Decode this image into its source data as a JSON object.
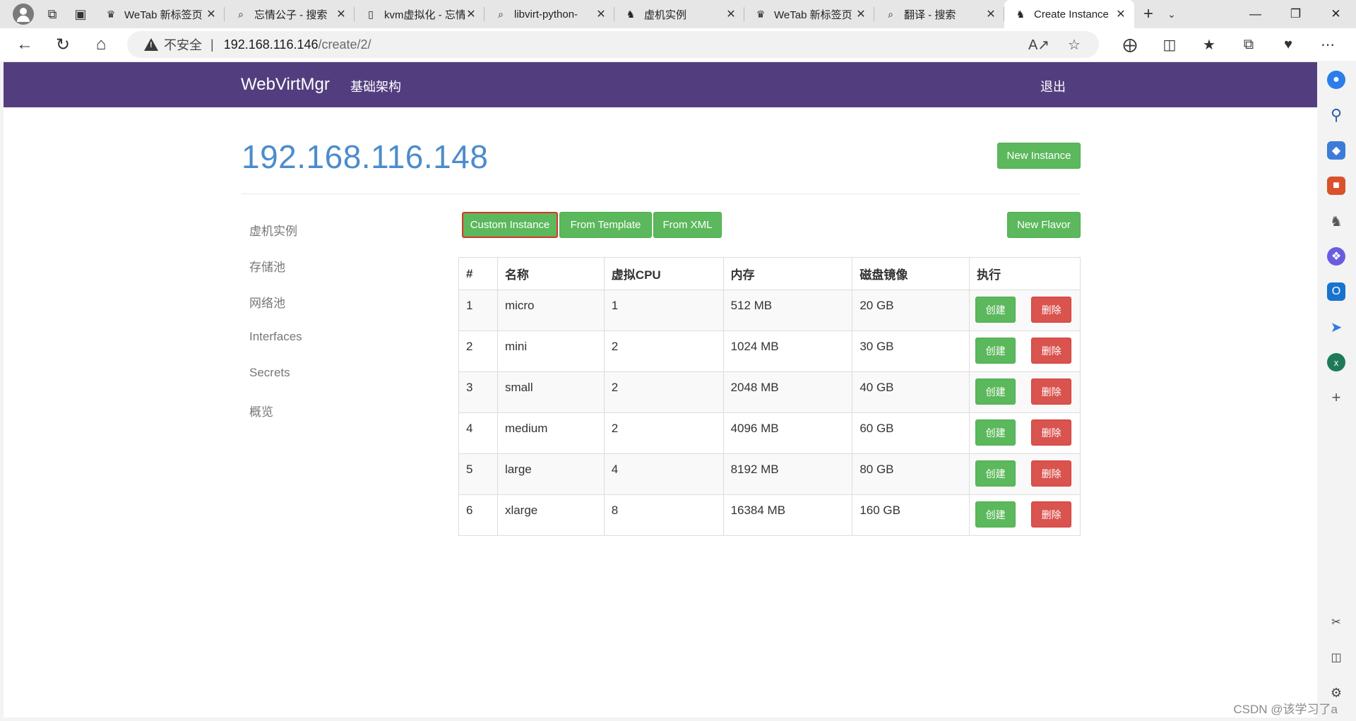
{
  "browser": {
    "tabs": [
      {
        "title": "WeTab 新标签页",
        "icon": "wetab-icon",
        "active": false
      },
      {
        "title": "忘情公子 - 搜索",
        "icon": "search-icon",
        "active": false
      },
      {
        "title": "kvm虚拟化 - 忘情公子",
        "icon": "page-icon",
        "active": false
      },
      {
        "title": "libvirt-python-",
        "icon": "search-icon",
        "active": false
      },
      {
        "title": "虚机实例",
        "icon": "webvirtmgr-icon",
        "active": false
      },
      {
        "title": "WeTab 新标签页",
        "icon": "wetab-icon",
        "active": false
      },
      {
        "title": "翻译 - 搜索",
        "icon": "search-icon",
        "active": false
      },
      {
        "title": "Create Instance",
        "icon": "webvirtmgr-icon",
        "active": true
      }
    ],
    "address": {
      "security_label": "不安全",
      "host": "192.168.116.146",
      "path": "/create/2/"
    }
  },
  "app": {
    "brand": "WebVirtMgr",
    "nav_link": "基础架构",
    "logout": "退出"
  },
  "page": {
    "title": "192.168.116.148",
    "new_instance": "New Instance",
    "custom_instance": "Custom Instance",
    "from_template": "From Template",
    "from_xml": "From XML",
    "new_flavor": "New Flavor"
  },
  "sidebar": {
    "items": [
      {
        "label": "虚机实例"
      },
      {
        "label": "存储池"
      },
      {
        "label": "网络池"
      },
      {
        "label": "Interfaces"
      },
      {
        "label": "Secrets"
      },
      {
        "label": "概览"
      }
    ]
  },
  "table": {
    "headers": [
      "#",
      "名称",
      "虚拟CPU",
      "内存",
      "磁盘镜像",
      "执行"
    ],
    "create_label": "创建",
    "delete_label": "删除",
    "rows": [
      {
        "id": "1",
        "name": "micro",
        "vcpu": "1",
        "memory": "512 MB",
        "disk": "20 GB"
      },
      {
        "id": "2",
        "name": "mini",
        "vcpu": "2",
        "memory": "1024 MB",
        "disk": "30 GB"
      },
      {
        "id": "3",
        "name": "small",
        "vcpu": "2",
        "memory": "2048 MB",
        "disk": "40 GB"
      },
      {
        "id": "4",
        "name": "medium",
        "vcpu": "2",
        "memory": "4096 MB",
        "disk": "60 GB"
      },
      {
        "id": "5",
        "name": "large",
        "vcpu": "4",
        "memory": "8192 MB",
        "disk": "80 GB"
      },
      {
        "id": "6",
        "name": "xlarge",
        "vcpu": "8",
        "memory": "16384 MB",
        "disk": "160 GB"
      }
    ]
  },
  "watermark": "CSDN @该学习了a",
  "colors": {
    "navbar": "#523e7f",
    "title": "#4c8ccc",
    "success": "#5cb85c",
    "danger": "#d9534f",
    "selection_outline": "#d9342b"
  }
}
